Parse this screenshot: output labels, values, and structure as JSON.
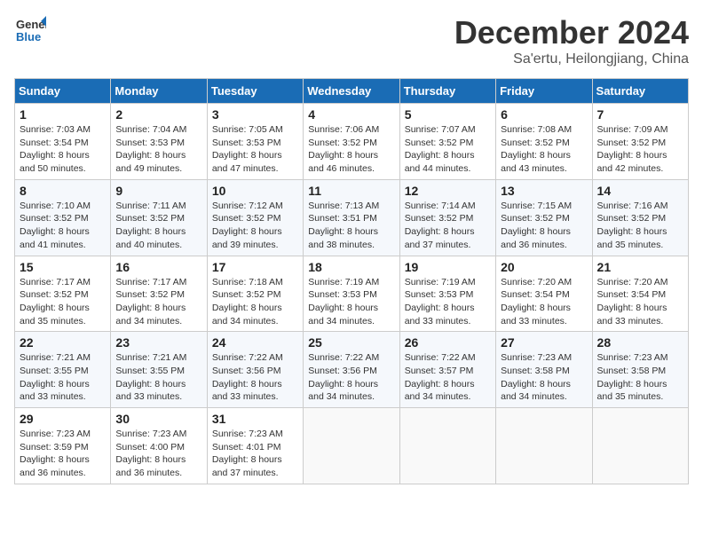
{
  "header": {
    "logo_line1": "General",
    "logo_line2": "Blue",
    "month": "December 2024",
    "location": "Sa'ertu, Heilongjiang, China"
  },
  "weekdays": [
    "Sunday",
    "Monday",
    "Tuesday",
    "Wednesday",
    "Thursday",
    "Friday",
    "Saturday"
  ],
  "weeks": [
    [
      {
        "day": "1",
        "sunrise": "7:03 AM",
        "sunset": "3:54 PM",
        "daylight": "8 hours and 50 minutes."
      },
      {
        "day": "2",
        "sunrise": "7:04 AM",
        "sunset": "3:53 PM",
        "daylight": "8 hours and 49 minutes."
      },
      {
        "day": "3",
        "sunrise": "7:05 AM",
        "sunset": "3:53 PM",
        "daylight": "8 hours and 47 minutes."
      },
      {
        "day": "4",
        "sunrise": "7:06 AM",
        "sunset": "3:52 PM",
        "daylight": "8 hours and 46 minutes."
      },
      {
        "day": "5",
        "sunrise": "7:07 AM",
        "sunset": "3:52 PM",
        "daylight": "8 hours and 44 minutes."
      },
      {
        "day": "6",
        "sunrise": "7:08 AM",
        "sunset": "3:52 PM",
        "daylight": "8 hours and 43 minutes."
      },
      {
        "day": "7",
        "sunrise": "7:09 AM",
        "sunset": "3:52 PM",
        "daylight": "8 hours and 42 minutes."
      }
    ],
    [
      {
        "day": "8",
        "sunrise": "7:10 AM",
        "sunset": "3:52 PM",
        "daylight": "8 hours and 41 minutes."
      },
      {
        "day": "9",
        "sunrise": "7:11 AM",
        "sunset": "3:52 PM",
        "daylight": "8 hours and 40 minutes."
      },
      {
        "day": "10",
        "sunrise": "7:12 AM",
        "sunset": "3:52 PM",
        "daylight": "8 hours and 39 minutes."
      },
      {
        "day": "11",
        "sunrise": "7:13 AM",
        "sunset": "3:51 PM",
        "daylight": "8 hours and 38 minutes."
      },
      {
        "day": "12",
        "sunrise": "7:14 AM",
        "sunset": "3:52 PM",
        "daylight": "8 hours and 37 minutes."
      },
      {
        "day": "13",
        "sunrise": "7:15 AM",
        "sunset": "3:52 PM",
        "daylight": "8 hours and 36 minutes."
      },
      {
        "day": "14",
        "sunrise": "7:16 AM",
        "sunset": "3:52 PM",
        "daylight": "8 hours and 35 minutes."
      }
    ],
    [
      {
        "day": "15",
        "sunrise": "7:17 AM",
        "sunset": "3:52 PM",
        "daylight": "8 hours and 35 minutes."
      },
      {
        "day": "16",
        "sunrise": "7:17 AM",
        "sunset": "3:52 PM",
        "daylight": "8 hours and 34 minutes."
      },
      {
        "day": "17",
        "sunrise": "7:18 AM",
        "sunset": "3:52 PM",
        "daylight": "8 hours and 34 minutes."
      },
      {
        "day": "18",
        "sunrise": "7:19 AM",
        "sunset": "3:53 PM",
        "daylight": "8 hours and 34 minutes."
      },
      {
        "day": "19",
        "sunrise": "7:19 AM",
        "sunset": "3:53 PM",
        "daylight": "8 hours and 33 minutes."
      },
      {
        "day": "20",
        "sunrise": "7:20 AM",
        "sunset": "3:54 PM",
        "daylight": "8 hours and 33 minutes."
      },
      {
        "day": "21",
        "sunrise": "7:20 AM",
        "sunset": "3:54 PM",
        "daylight": "8 hours and 33 minutes."
      }
    ],
    [
      {
        "day": "22",
        "sunrise": "7:21 AM",
        "sunset": "3:55 PM",
        "daylight": "8 hours and 33 minutes."
      },
      {
        "day": "23",
        "sunrise": "7:21 AM",
        "sunset": "3:55 PM",
        "daylight": "8 hours and 33 minutes."
      },
      {
        "day": "24",
        "sunrise": "7:22 AM",
        "sunset": "3:56 PM",
        "daylight": "8 hours and 33 minutes."
      },
      {
        "day": "25",
        "sunrise": "7:22 AM",
        "sunset": "3:56 PM",
        "daylight": "8 hours and 34 minutes."
      },
      {
        "day": "26",
        "sunrise": "7:22 AM",
        "sunset": "3:57 PM",
        "daylight": "8 hours and 34 minutes."
      },
      {
        "day": "27",
        "sunrise": "7:23 AM",
        "sunset": "3:58 PM",
        "daylight": "8 hours and 34 minutes."
      },
      {
        "day": "28",
        "sunrise": "7:23 AM",
        "sunset": "3:58 PM",
        "daylight": "8 hours and 35 minutes."
      }
    ],
    [
      {
        "day": "29",
        "sunrise": "7:23 AM",
        "sunset": "3:59 PM",
        "daylight": "8 hours and 36 minutes."
      },
      {
        "day": "30",
        "sunrise": "7:23 AM",
        "sunset": "4:00 PM",
        "daylight": "8 hours and 36 minutes."
      },
      {
        "day": "31",
        "sunrise": "7:23 AM",
        "sunset": "4:01 PM",
        "daylight": "8 hours and 37 minutes."
      },
      null,
      null,
      null,
      null
    ]
  ]
}
